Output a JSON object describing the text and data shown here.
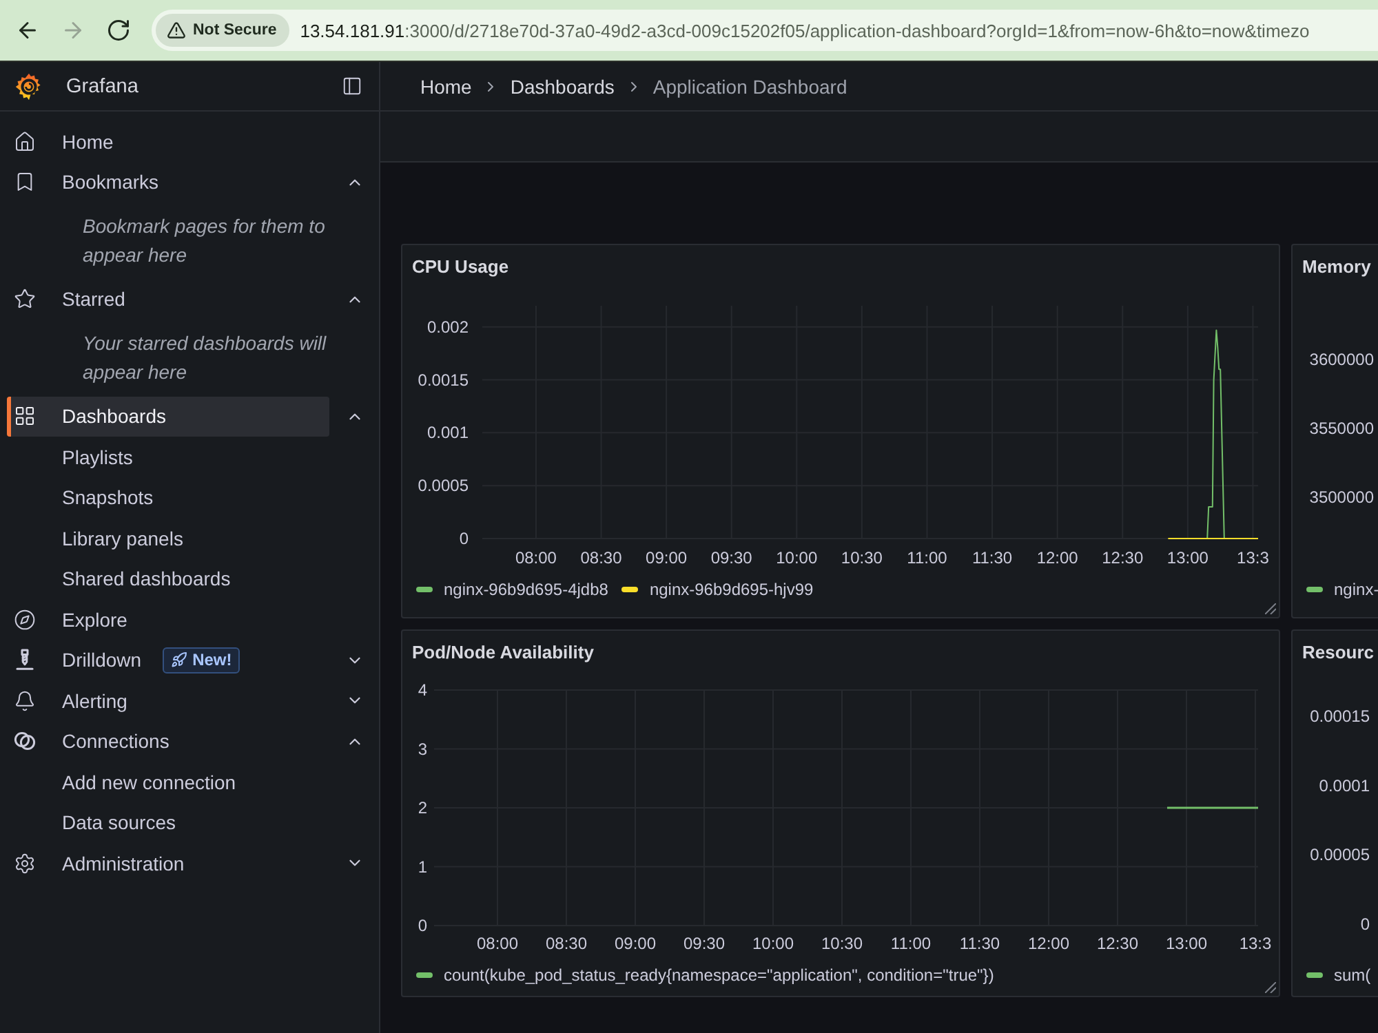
{
  "browser": {
    "nav_buttons": [
      {
        "kind": "back",
        "disabled": false
      },
      {
        "kind": "forward",
        "disabled": true
      },
      {
        "kind": "reload",
        "disabled": false
      }
    ],
    "security_chip": "Not Secure",
    "url": {
      "host": "13.54.181.91",
      "path": ":3000/d/2718e70d-37a0-49d2-a3cd-009c15202f05/application-dashboard?orgId=1&from=now-6h&to=now&timezo"
    }
  },
  "sidebar": {
    "brand": "Grafana",
    "items": [
      {
        "label": "Home",
        "selected": false
      },
      {
        "label": "Bookmarks",
        "selected": false,
        "expanded": true,
        "note": "Bookmark pages for them to appear here"
      },
      {
        "label": "Starred",
        "selected": false,
        "expanded": true,
        "note": "Your starred dashboards will appear here"
      },
      {
        "label": "Dashboards",
        "selected": true,
        "expanded": true,
        "children": [
          {
            "label": "Playlists",
            "selected": false
          },
          {
            "label": "Snapshots",
            "selected": false
          },
          {
            "label": "Library panels",
            "selected": false
          },
          {
            "label": "Shared dashboards",
            "selected": false
          }
        ]
      },
      {
        "label": "Explore",
        "selected": false
      },
      {
        "label": "Drilldown",
        "selected": false,
        "expanded": false,
        "badge": "New!"
      },
      {
        "label": "Alerting",
        "selected": false,
        "expanded": false
      },
      {
        "label": "Connections",
        "selected": false,
        "expanded": true,
        "children": [
          {
            "label": "Add new connection",
            "selected": false
          },
          {
            "label": "Data sources",
            "selected": false
          }
        ]
      },
      {
        "label": "Administration",
        "selected": false,
        "expanded": false
      }
    ]
  },
  "breadcrumbs": [
    {
      "label": "Home",
      "current": false
    },
    {
      "label": "Dashboards",
      "current": false
    },
    {
      "label": "Application Dashboard",
      "current": true
    }
  ],
  "panels": [
    {
      "title": "CPU Usage",
      "chart_data": {
        "type": "line",
        "grid": true,
        "x": [
          12.85,
          13.15,
          13.16,
          13.19,
          13.2,
          13.22,
          13.23,
          13.24,
          13.25,
          13.28,
          13.54
        ],
        "series": [
          {
            "name": "nginx-96b9d695-4jdb8",
            "color": "#73bf69",
            "values": [
              null,
              0,
              0.0003,
              0.0003,
              0.0015,
              0.00197,
              0.0018,
              0.0016,
              0.0016,
              0,
              null
            ]
          },
          {
            "name": "nginx-96b9d695-hjv99",
            "color": "#fade2a",
            "values": [
              0,
              0,
              0,
              0,
              0,
              0,
              0,
              0,
              0,
              0,
              0
            ]
          }
        ],
        "xlim": [
          7.588,
          13.54
        ],
        "ylim": [
          0,
          0.0022
        ],
        "xticks": [
          {
            "value": 8,
            "label": "08:00"
          },
          {
            "value": 8.5,
            "label": "08:30"
          },
          {
            "value": 9,
            "label": "09:00"
          },
          {
            "value": 9.5,
            "label": "09:30"
          },
          {
            "value": 10,
            "label": "10:00"
          },
          {
            "value": 10.5,
            "label": "10:30"
          },
          {
            "value": 11,
            "label": "11:00"
          },
          {
            "value": 11.5,
            "label": "11:30"
          },
          {
            "value": 12,
            "label": "12:00"
          },
          {
            "value": 12.5,
            "label": "12:30"
          },
          {
            "value": 13,
            "label": "13:00"
          },
          {
            "value": 13.5,
            "label": "13:3"
          }
        ],
        "yticks": [
          0,
          0.0005,
          0.001,
          0.0015,
          0.002
        ]
      }
    },
    {
      "title": "Memory",
      "axis_labels": [
        "3600000",
        "3550000",
        "3500000"
      ],
      "legend": [
        {
          "label": "nginx-",
          "color": "#73bf69"
        }
      ]
    },
    {
      "title": "Pod/Node Availability",
      "chart_data": {
        "type": "line",
        "grid": true,
        "x": [
          12.86,
          13.52
        ],
        "series": [
          {
            "name": "count(kube_pod_status_ready{namespace=\"application\", condition=\"true\"})",
            "color": "#73bf69",
            "values": [
              2,
              2
            ]
          }
        ],
        "xlim": [
          7.54,
          13.52
        ],
        "ylim": [
          0,
          4
        ],
        "xticks": [
          {
            "value": 8,
            "label": "08:00"
          },
          {
            "value": 8.5,
            "label": "08:30"
          },
          {
            "value": 9,
            "label": "09:00"
          },
          {
            "value": 9.5,
            "label": "09:30"
          },
          {
            "value": 10,
            "label": "10:00"
          },
          {
            "value": 10.5,
            "label": "10:30"
          },
          {
            "value": 11,
            "label": "11:00"
          },
          {
            "value": 11.5,
            "label": "11:30"
          },
          {
            "value": 12,
            "label": "12:00"
          },
          {
            "value": 12.5,
            "label": "12:30"
          },
          {
            "value": 13,
            "label": "13:00"
          },
          {
            "value": 13.5,
            "label": "13:3"
          }
        ],
        "yticks": [
          0,
          1,
          2,
          3,
          4
        ]
      }
    },
    {
      "title": "Resourc",
      "axis_labels": [
        "0.00015",
        "0.0001",
        "0.00005",
        "0"
      ],
      "legend": [
        {
          "label": "sum(",
          "color": "#73bf69"
        }
      ]
    }
  ]
}
